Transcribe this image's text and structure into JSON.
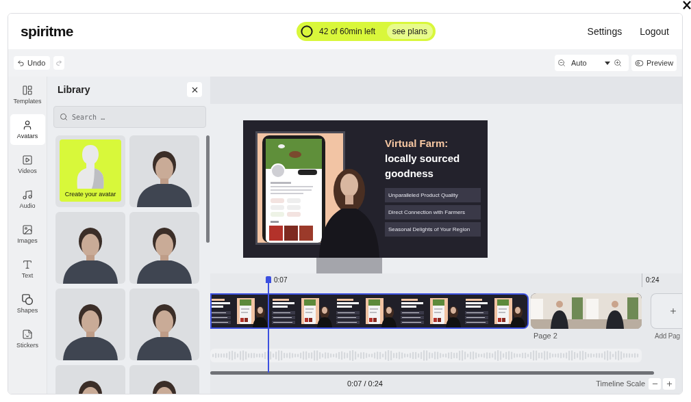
{
  "header": {
    "logo": "spiritme",
    "usage": {
      "label": "42 of 60min left",
      "action": "see plans"
    },
    "links": [
      "Settings",
      "Logout"
    ]
  },
  "toolbar": {
    "undo": "Undo",
    "zoom": "Auto",
    "preview": "Preview"
  },
  "sidebar": {
    "items": [
      {
        "label": "Templates",
        "selected": false
      },
      {
        "label": "Avatars",
        "selected": true
      },
      {
        "label": "Videos",
        "selected": false
      },
      {
        "label": "Audio",
        "selected": false
      },
      {
        "label": "Images",
        "selected": false
      },
      {
        "label": "Text",
        "selected": false
      },
      {
        "label": "Shapes",
        "selected": false
      },
      {
        "label": "Stickers",
        "selected": false
      }
    ]
  },
  "library": {
    "title": "Library",
    "search": {
      "placeholder": "Search …"
    },
    "cards": [
      {
        "kind": "create",
        "label": "Create your avatar"
      },
      {
        "kind": "photo"
      },
      {
        "kind": "photo"
      },
      {
        "kind": "photo"
      },
      {
        "kind": "photo"
      },
      {
        "kind": "photo"
      },
      {
        "kind": "photo"
      },
      {
        "kind": "photo"
      }
    ]
  },
  "slide": {
    "title_accent": "Virtual Farm:",
    "title": "locally sourced goodness",
    "bullets": [
      "Unparalleled Product Quality",
      "Direct Connection with Farmers",
      "Seasonal Delights of Your Region"
    ]
  },
  "timeline": {
    "playhead": "0:07",
    "end": "0:24",
    "pages": [
      {
        "kind": "slides",
        "selected": true
      },
      {
        "kind": "photos",
        "selected": false,
        "label": "Page 2"
      }
    ],
    "add_page": "Add Pag",
    "position": "0:07 / 0:24",
    "scale": "Timeline Scale"
  }
}
